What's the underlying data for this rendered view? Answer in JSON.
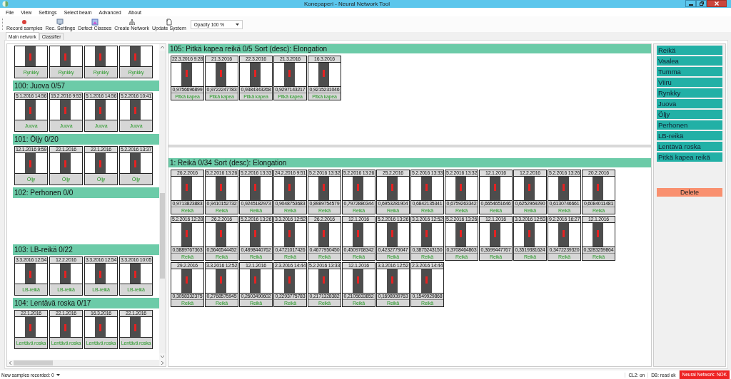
{
  "window": {
    "title": "Konepaperi - Neural Network Tool"
  },
  "menu": [
    "File",
    "View",
    "Settings",
    "Select beam",
    "Advanced",
    "About"
  ],
  "toolbar": [
    {
      "label": "Record samples",
      "kind": "record"
    },
    {
      "label": "Rec. Settings",
      "kind": "settings"
    },
    {
      "label": "Defect Classes",
      "kind": "classes"
    },
    {
      "label": "Create Network",
      "kind": "network"
    },
    {
      "label": "Update System",
      "kind": "update"
    }
  ],
  "opacity": {
    "value": "Opacity 100 %"
  },
  "tabs": [
    {
      "label": "Main network",
      "selected": true
    },
    {
      "label": "Classifier",
      "selected": false
    }
  ],
  "left_panel": {
    "groups": [
      {
        "cards": [
          {
            "label": "Rynkky"
          },
          {
            "label": "Rynkky"
          },
          {
            "label": "Rynkky"
          },
          {
            "label": "Rynkky"
          }
        ]
      },
      {
        "title": "100: Juova 0/57",
        "cards": [
          {
            "date": "5.1.2016 14:56",
            "label": "Juova"
          },
          {
            "date": "15.2.2016 9:53",
            "label": "Juova"
          },
          {
            "date": "5.1.2016 14:56",
            "label": "Juova"
          },
          {
            "date": "5.2.2016 10:41",
            "label": "Juova"
          }
        ]
      },
      {
        "title": "101: Öljy 0/20",
        "cards": [
          {
            "date": "12.1.2016 9:59",
            "label": "Öljy"
          },
          {
            "date": "22.1.2016",
            "label": "Öljy"
          },
          {
            "date": "22.1.2016",
            "label": "Öljy"
          },
          {
            "date": "5.2.2016 13:37",
            "label": "Öljy"
          }
        ]
      },
      {
        "title": "102: Perhonen 0/0"
      },
      {
        "title": "103: LB-reikä 0/22",
        "cards": [
          {
            "date": "3.3.2016 12:54",
            "label": "LB-reikä"
          },
          {
            "date": "12.2.2016",
            "label": "LB-reikä"
          },
          {
            "date": "3.3.2016 12:54",
            "label": "LB-reikä"
          },
          {
            "date": "3.3.2016 10:05",
            "label": "LB-reikä"
          }
        ]
      },
      {
        "title": "104: Lentävä roska 0/17",
        "cards": [
          {
            "date": "22.1.2016",
            "label": "Lentävä roska"
          },
          {
            "date": "22.1.2016",
            "label": "Lentävä roska"
          },
          {
            "date": "16.3.2016",
            "label": "Lentävä roska"
          },
          {
            "date": "22.1.2016",
            "label": "Lentävä roska"
          }
        ]
      }
    ]
  },
  "top_section": {
    "title": "105: Pitkä kapea reikä 0/5 Sort (desc): Elongation",
    "cards": [
      {
        "date": "22.3.2016 9:28",
        "score": "0,9756696899",
        "label": "Pitkä kapea"
      },
      {
        "date": "21.3.2016",
        "score": "0,9722247783",
        "label": "Pitkä kapea"
      },
      {
        "date": "22.3.2016",
        "score": "0,9384343268",
        "label": "Pitkä kapea"
      },
      {
        "date": "21.3.2016",
        "score": "0,9297143217",
        "label": "Pitkä kapea"
      },
      {
        "date": "16.3.2016",
        "score": "0,9215231046",
        "label": "Pitkä kapea"
      }
    ]
  },
  "main_section": {
    "title": "1: Reikä 0/34 Sort (desc): Elongation",
    "cards": [
      {
        "date": "26.2.2016",
        "score": "0,9713823883",
        "label": "Reikä"
      },
      {
        "date": "5.2.2016 13:26",
        "score": "0,9410152732",
        "label": "Reikä"
      },
      {
        "date": "5.2.2016 13:33",
        "score": "0,9245182973",
        "label": "Reikä"
      },
      {
        "date": "24.2.2016 9:51",
        "score": "0,9048753683",
        "label": "Reikä"
      },
      {
        "date": "5.2.2016 13:32",
        "score": "0,8989754579",
        "label": "Reikä"
      },
      {
        "date": "5.2.2016 13:26",
        "score": "0,7972880344",
        "label": "Reikä"
      },
      {
        "date": "25.2.2016",
        "score": "0,6953281904",
        "label": "Reikä"
      },
      {
        "date": "5.2.2016 13:33",
        "score": "0,6842135341",
        "label": "Reikä"
      },
      {
        "date": "5.2.2016 13:32",
        "score": "0,6759263342",
        "label": "Reikä"
      },
      {
        "date": "12.1.2016",
        "score": "0,6654651646",
        "label": "Reikä"
      },
      {
        "date": "12.2.2016",
        "score": "0,6252969290",
        "label": "Reikä"
      },
      {
        "date": "5.2.2016 13:26",
        "score": "0,6130746661",
        "label": "Reikä"
      },
      {
        "date": "20.2.2016",
        "score": "0,6084011481",
        "label": "Reikä"
      },
      {
        "date": "5.2.2016 12:28",
        "score": "0,5889767363",
        "label": "Reikä"
      },
      {
        "date": "26.2.2016",
        "score": "0,5646544452",
        "label": "Reikä"
      },
      {
        "date": "5.2.2016 13:26",
        "score": "0,4898440762",
        "label": "Reikä"
      },
      {
        "date": "3.3.2016 12:52",
        "score": "0,4721017426",
        "label": "Reikä"
      },
      {
        "date": "26.2.2016",
        "score": "0,4677950450",
        "label": "Reikä"
      },
      {
        "date": "12.1.2016",
        "score": "0,4509768342",
        "label": "Reikä"
      },
      {
        "date": "5.2.2016 13:26",
        "score": "0,4232779047",
        "label": "Reikä"
      },
      {
        "date": "3.3.2016 12:52",
        "score": "0,3875243150",
        "label": "Reikä"
      },
      {
        "date": "5.2.2016 13:26",
        "score": "0,3708464863",
        "label": "Reikä"
      },
      {
        "date": "12.1.2016",
        "score": "0,3699447767",
        "label": "Reikä"
      },
      {
        "date": "3.3.2016 12:53",
        "score": "0,3519381624",
        "label": "Reikä"
      },
      {
        "date": "9.2.2016 16:27",
        "score": "0,3472239320",
        "label": "Reikä"
      },
      {
        "date": "12.1.2016",
        "score": "0,3283259864",
        "label": "Reikä"
      },
      {
        "date": "29.2.2016",
        "score": "0,3058332375",
        "label": "Reikä"
      },
      {
        "date": "3.3.2016 12:52",
        "score": "0,2768575945",
        "label": "Reikä"
      },
      {
        "date": "12.1.2016",
        "score": "0,2603490602",
        "label": "Reikä"
      },
      {
        "date": "2.3.2016 14:44",
        "score": "0,2293775783",
        "label": "Reikä"
      },
      {
        "date": "5.2.2016 13:33",
        "score": "0,2171328382",
        "label": "Reikä"
      },
      {
        "date": "12.1.2016",
        "score": "0,2105633852",
        "label": "Reikä"
      },
      {
        "date": "3.3.2016 12:52",
        "score": "0,1698939763",
        "label": "Reikä"
      },
      {
        "date": "2.3.2016 14:44",
        "score": "0,1549929868",
        "label": "Reikä"
      }
    ]
  },
  "classes": [
    "Reikä",
    "Vaalea",
    "Tumma",
    "Viiru",
    "Rynkky",
    "Juova",
    "Öljy",
    "Perhonen",
    "LB-reikä",
    "Lentävä roska",
    "Pitkä kapea reikä"
  ],
  "delete_button": "Delete",
  "status_bar": {
    "samples": "New samples recorded: 0",
    "cl2": "CL2: on",
    "db": "DB: read ok",
    "network": "Neural Network: NOK"
  }
}
